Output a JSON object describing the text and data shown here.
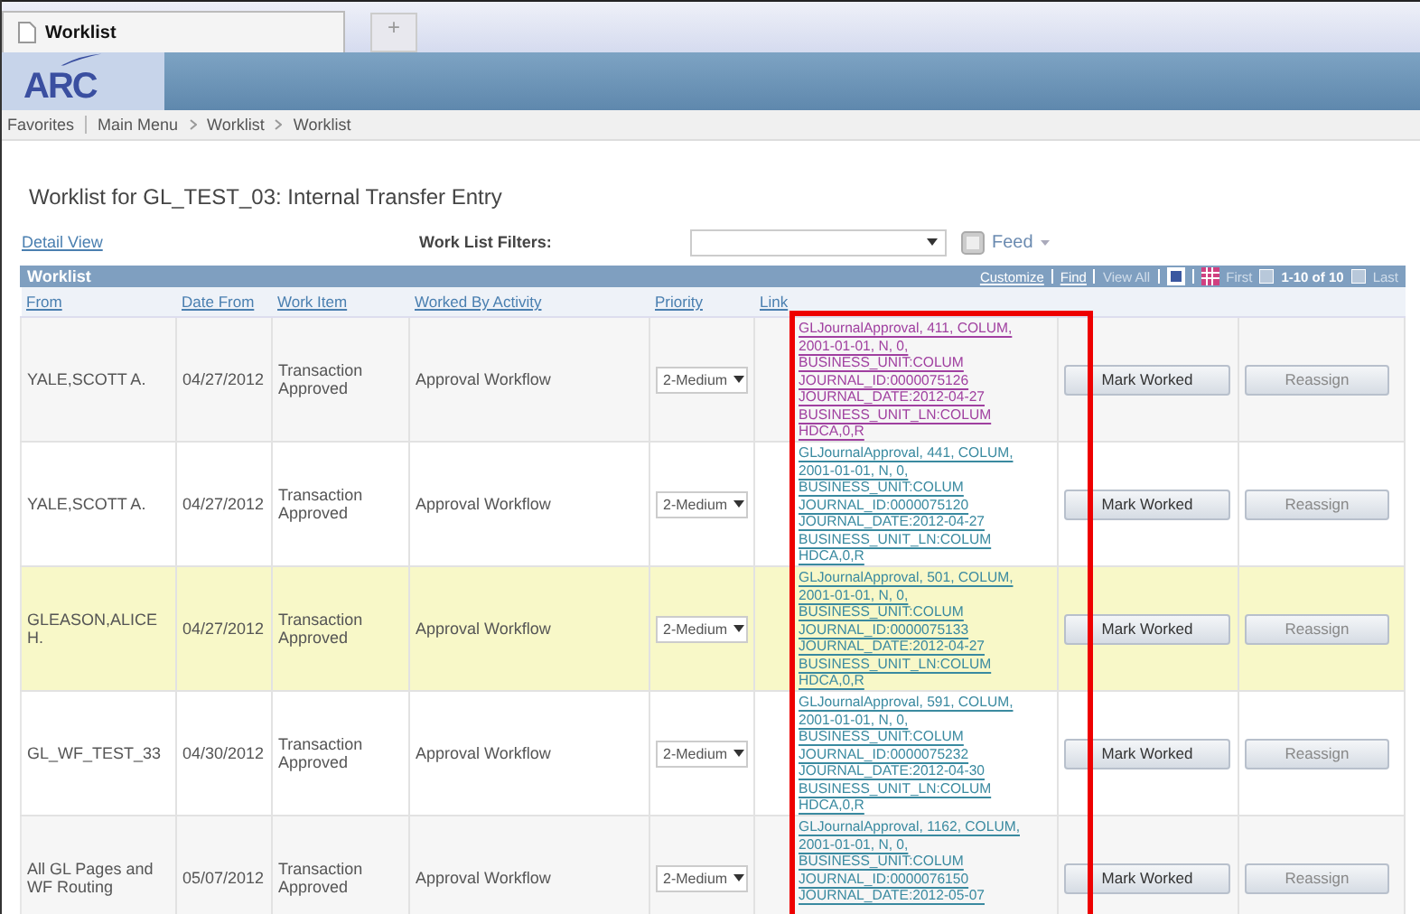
{
  "browser_tab": {
    "title": "Worklist",
    "new_tab": "+"
  },
  "logo": "ARC",
  "breadcrumb": [
    "Favorites",
    "Main Menu",
    "Worklist",
    "Worklist"
  ],
  "page_title": "Worklist for GL_TEST_03: Internal Transfer Entry",
  "detail_view": "Detail View",
  "filters": {
    "label": "Work List Filters:",
    "feed": "Feed"
  },
  "grid": {
    "title": "Worklist",
    "toolbar": [
      {
        "label": "Customize",
        "disabled": false
      },
      {
        "label": "Find",
        "disabled": false
      },
      {
        "label": "View All",
        "disabled": true
      }
    ],
    "first": "First",
    "range": "1-10 of 10",
    "last": "Last",
    "columns": [
      "From",
      "Date From",
      "Work Item",
      "Worked By Activity",
      "Priority",
      "Link"
    ],
    "rows": [
      {
        "from": "YALE,SCOTT A.",
        "date": "04/27/2012",
        "item": "Transaction Approved",
        "activity": "Approval Workflow",
        "priority": "2-Medium",
        "visited": true,
        "highlighted": false,
        "link": [
          "GLJournalApproval, 411, COLUM,",
          "2001-01-01, N, 0,",
          "BUSINESS_UNIT:COLUM",
          "JOURNAL_ID:0000075126",
          "JOURNAL_DATE:2012-04-27",
          "BUSINESS_UNIT_LN:COLUM",
          "HDCA,0,R"
        ],
        "mark": "Mark Worked",
        "reassign": "Reassign"
      },
      {
        "from": "YALE,SCOTT A.",
        "date": "04/27/2012",
        "item": "Transaction Approved",
        "activity": "Approval Workflow",
        "priority": "2-Medium",
        "visited": false,
        "highlighted": false,
        "link": [
          "GLJournalApproval, 441, COLUM,",
          "2001-01-01, N, 0,",
          "BUSINESS_UNIT:COLUM",
          "JOURNAL_ID:0000075120",
          "JOURNAL_DATE:2012-04-27",
          "BUSINESS_UNIT_LN:COLUM",
          "HDCA,0,R"
        ],
        "mark": "Mark Worked",
        "reassign": "Reassign"
      },
      {
        "from": "GLEASON,ALICE H.",
        "date": "04/27/2012",
        "item": "Transaction Approved",
        "activity": "Approval Workflow",
        "priority": "2-Medium",
        "visited": false,
        "highlighted": true,
        "link": [
          "GLJournalApproval, 501, COLUM,",
          "2001-01-01, N, 0,",
          "BUSINESS_UNIT:COLUM",
          "JOURNAL_ID:0000075133",
          "JOURNAL_DATE:2012-04-27",
          "BUSINESS_UNIT_LN:COLUM",
          "HDCA,0,R"
        ],
        "mark": "Mark Worked",
        "reassign": "Reassign"
      },
      {
        "from": "GL_WF_TEST_33",
        "date": "04/30/2012",
        "item": "Transaction Approved",
        "activity": "Approval Workflow",
        "priority": "2-Medium",
        "visited": false,
        "highlighted": false,
        "link": [
          "GLJournalApproval, 591, COLUM,",
          "2001-01-01, N, 0,",
          "BUSINESS_UNIT:COLUM",
          "JOURNAL_ID:0000075232",
          "JOURNAL_DATE:2012-04-30",
          "BUSINESS_UNIT_LN:COLUM",
          "HDCA,0,R"
        ],
        "mark": "Mark Worked",
        "reassign": "Reassign"
      },
      {
        "from": "All GL Pages and WF Routing",
        "date": "05/07/2012",
        "item": "Transaction Approved",
        "activity": "Approval Workflow",
        "priority": "2-Medium",
        "visited": false,
        "highlighted": false,
        "link": [
          "GLJournalApproval, 1162, COLUM,",
          "2001-01-01, N, 0,",
          "BUSINESS_UNIT:COLUM",
          "JOURNAL_ID:0000076150",
          "JOURNAL_DATE:2012-05-07"
        ],
        "mark": "Mark Worked",
        "reassign": "Reassign"
      }
    ]
  }
}
